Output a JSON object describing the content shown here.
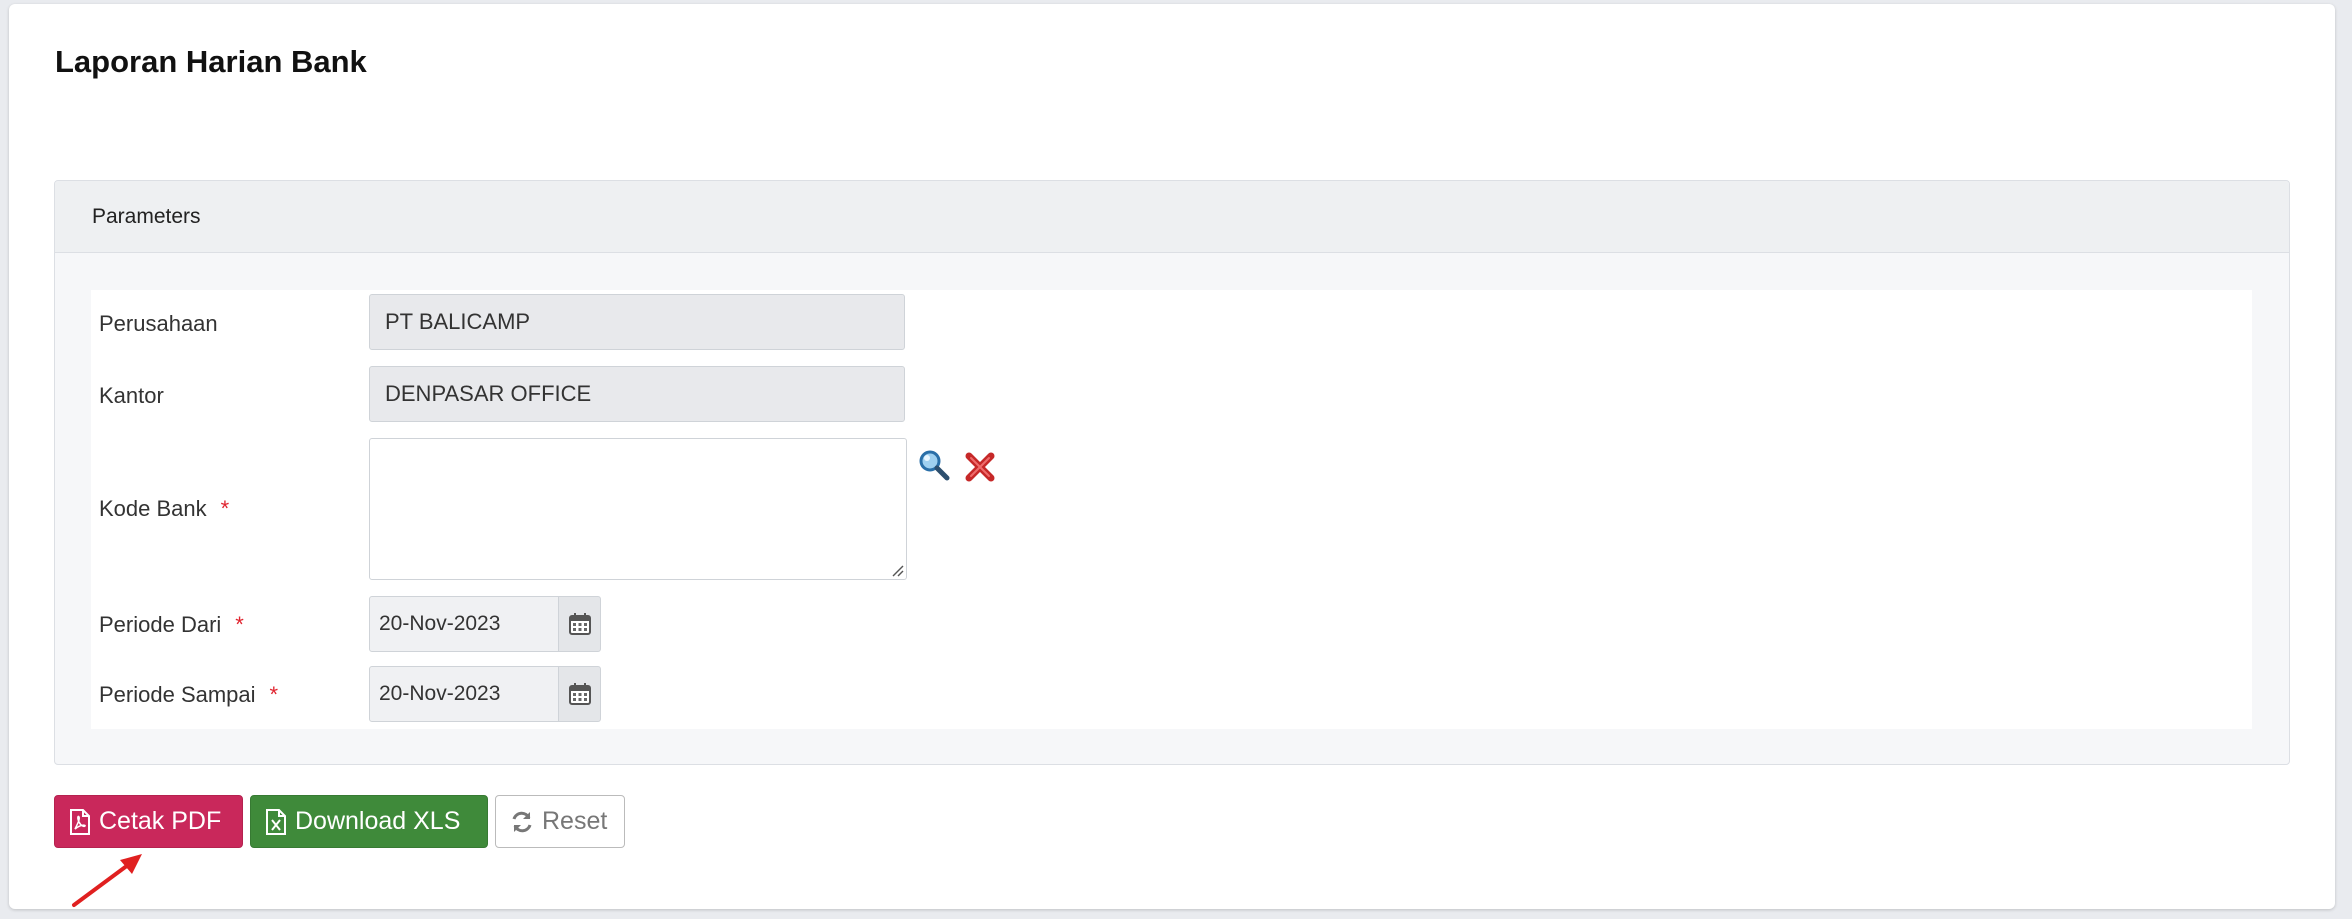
{
  "page": {
    "title": "Laporan Harian Bank"
  },
  "panel": {
    "header": "Parameters"
  },
  "form": {
    "perusahaan": {
      "label": "Perusahaan",
      "value": "PT BALICAMP"
    },
    "kantor": {
      "label": "Kantor",
      "value": "DENPASAR OFFICE"
    },
    "kode_bank": {
      "label": "Kode Bank",
      "required_mark": "*",
      "value": ""
    },
    "periode_dari": {
      "label": "Periode Dari",
      "required_mark": "*",
      "value": "20-Nov-2023"
    },
    "periode_sampai": {
      "label": "Periode Sampai",
      "required_mark": "*",
      "value": "20-Nov-2023"
    }
  },
  "buttons": {
    "cetak_pdf": "Cetak PDF",
    "download_xls": "Download XLS",
    "reset": "Reset"
  },
  "icons": {
    "lookup": "search-icon",
    "clear": "close-icon",
    "calendar": "calendar-icon",
    "pdf": "file-pdf-icon",
    "xls": "file-excel-icon",
    "reset": "refresh-icon"
  },
  "colors": {
    "pdf_button": "#c9285b",
    "xls_button": "#3f8a3a",
    "required": "#e0242f",
    "annotation_arrow": "#e02020"
  }
}
